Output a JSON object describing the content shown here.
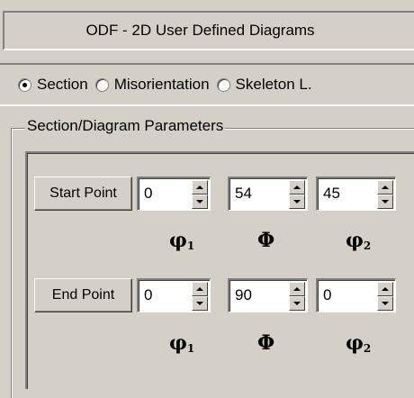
{
  "title": "ODF - 2D User Defined Diagrams",
  "mode_options": [
    {
      "label": "Section",
      "checked": true
    },
    {
      "label": "Misorientation",
      "checked": false
    },
    {
      "label": "Skeleton L.",
      "checked": false
    }
  ],
  "group_title": "Section/Diagram Parameters",
  "start_point": {
    "button_label": "Start Point",
    "values": [
      "0",
      "54",
      "45"
    ]
  },
  "end_point": {
    "button_label": "End Point",
    "values": [
      "0",
      "90",
      "0"
    ]
  },
  "angle_labels": {
    "phi1": "φ",
    "phi1_sub": "1",
    "Phi": "Φ",
    "phi2": "φ",
    "phi2_sub": "2"
  }
}
